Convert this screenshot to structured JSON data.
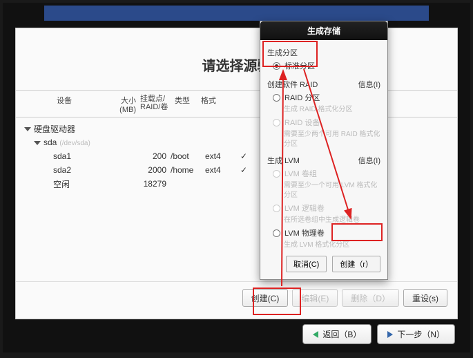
{
  "main": {
    "title": "请选择源驱",
    "columns": {
      "device": "设备",
      "size": "大小\n(MB)",
      "mount": "挂载点/\nRAID/卷",
      "type": "类型",
      "format": "格式"
    },
    "rows": {
      "group": "硬盘驱动器",
      "disk": "sda",
      "disk_path": "(/dev/sda)",
      "p1": {
        "name": "sda1",
        "size": "200",
        "mnt": "/boot",
        "type": "ext4"
      },
      "p2": {
        "name": "sda2",
        "size": "2000",
        "mnt": "/home",
        "type": "ext4"
      },
      "free": {
        "name": "空闲",
        "size": "18279"
      }
    },
    "buttons": {
      "create": "创建(C)",
      "edit": "编辑(E)",
      "delete": "删除（D）",
      "reset": "重设(s)"
    }
  },
  "nav": {
    "back": "返回（B）",
    "next": "下一步（N）"
  },
  "dialog": {
    "title": "生成存储",
    "section1": "生成分区",
    "opt_std": "标准分区",
    "section2": "创建软件 RAID",
    "info": "信息(I)",
    "opt_raid_part": "RAID 分区",
    "note_raid1": "生成 RAID 格式化分区",
    "opt_raid_dev": "RAID 设备",
    "note_raid2": "需要至少两个可用 RAID 格式化分区",
    "section3": "生成 LVM",
    "opt_vg": "LVM 卷组",
    "note_vg": "需要至少一个可用 LVM 格式化分区",
    "opt_lv": "LVM 逻辑卷",
    "note_lv": "在所选卷组中生成逻辑卷",
    "opt_pv": "LVM 物理卷",
    "note_pv": "生成 LVM 格式化分区",
    "cancel": "取消(C)",
    "create": "创建（r）"
  }
}
